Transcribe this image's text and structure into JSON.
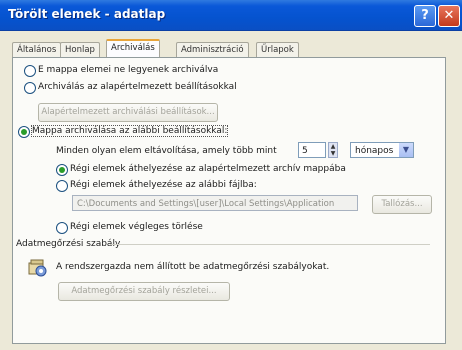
{
  "window": {
    "title": "Törölt elemek - adatlap",
    "help_label": "?",
    "close_label": "✕"
  },
  "tabs": [
    {
      "label": "Általános"
    },
    {
      "label": "Honlap"
    },
    {
      "label": "Archiválás"
    },
    {
      "label": "Adminisztráció"
    },
    {
      "label": "Űrlapok"
    }
  ],
  "options": {
    "no_archive": "E mappa elemei ne legyenek archiválva",
    "default_archive": "Archiválás az alapértelmezett beállításokkal",
    "default_settings_button": "Alapértelmezett archiválási beállítások...",
    "custom_archive": "Mappa archiválása az alábbi beállításokkal:",
    "older_than_label": "Minden olyan elem eltávolítása, amely több mint",
    "months_value": "5",
    "unit_value": "hónapos",
    "move_default": "Régi elemek áthelyezése az alapértelmezett archív mappába",
    "move_to_folder": "Régi elemek áthelyezése az alábbi fájlba:",
    "path_value": "C:\\Documents and Settings\\[user]\\Local Settings\\Application",
    "browse_button": "Tallózás...",
    "delete_permanent": "Régi elemek végleges törlése"
  },
  "policy": {
    "title": "Adatmegőrzési szabály",
    "text": "A rendszergazda nem állított be adatmegőrzési szabályokat.",
    "button": "Adatmegőrzési szabály részletei..."
  }
}
